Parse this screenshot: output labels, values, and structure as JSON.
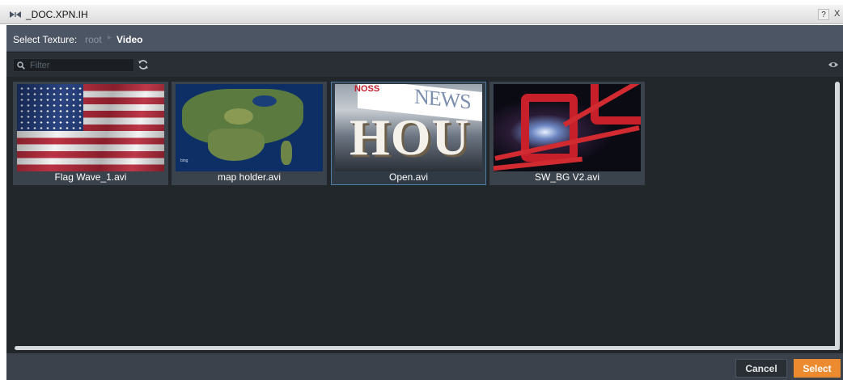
{
  "window": {
    "title": "_DOC.XPN.IH",
    "help_label": "?",
    "close_label": "X"
  },
  "header": {
    "label": "Select Texture:",
    "breadcrumb_root": "root",
    "breadcrumb_current": "Video"
  },
  "toolbar": {
    "filter_placeholder": "Filter"
  },
  "textures": [
    {
      "name": "Flag Wave_1.avi",
      "selected": false,
      "thumbnail": "us-flag"
    },
    {
      "name": "map holder.avi",
      "selected": false,
      "thumbnail": "satellite-map"
    },
    {
      "name": "Open.avi",
      "selected": true,
      "thumbnail": "news-hour"
    },
    {
      "name": "SW_BG V2.avi",
      "selected": false,
      "thumbnail": "red-abstract"
    }
  ],
  "thumbnail_text": {
    "map_brand": "bing",
    "news_logo": "NOSS",
    "news_word": "NEWS",
    "news_big": "HOU"
  },
  "footer": {
    "cancel_label": "Cancel",
    "select_label": "Select"
  },
  "colors": {
    "accent": "#ec8a2f",
    "selection_border": "#4f7ea8",
    "panel_bg": "#22272c",
    "header_bg": "#4b5563"
  }
}
